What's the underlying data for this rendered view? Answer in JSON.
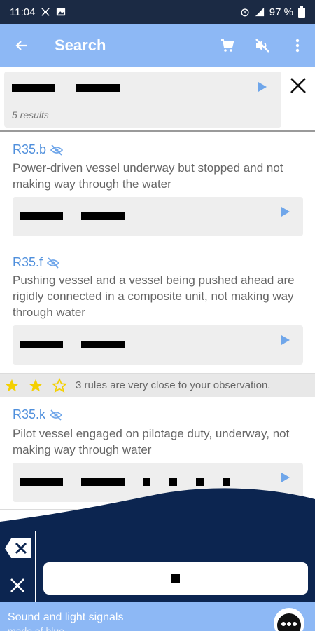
{
  "status_bar": {
    "time": "11:04",
    "battery": "97 %"
  },
  "app_bar": {
    "title": "Search",
    "back_icon": "arrow-back-icon",
    "actions": [
      "cart-icon",
      "volume-off-icon",
      "more-vert-icon"
    ]
  },
  "search": {
    "query_signal": [
      "dash",
      "dash"
    ],
    "results_count": "5 results"
  },
  "results": [
    {
      "rule_id": "R35.b",
      "description": "Power-driven vessel underway but stopped and not making way through the water",
      "signal": [
        "dash",
        "dash"
      ]
    },
    {
      "rule_id": "R35.f",
      "description": "Pushing vessel and a vessel being pushed ahead are rigidly connected in a composite unit, not making way through water",
      "signal": [
        "dash",
        "dash"
      ]
    },
    {
      "rule_id": "R35.k",
      "description": "Pilot vessel engaged on pilotage duty, underway, not making way through water",
      "signal": [
        "dash",
        "dash",
        "dot",
        "dot",
        "dot",
        "dot"
      ]
    }
  ],
  "rating": {
    "stars_filled": 2,
    "stars_total": 3,
    "text": "3 rules are very close to your observation."
  },
  "keyboard": {
    "backspace_icon": "backspace-icon",
    "cancel_icon": "close-icon",
    "dot_key_symbol": "dot"
  },
  "promo": {
    "title": "Sound and light signals",
    "subtitle": "made of blue"
  },
  "colors": {
    "status_bar": "#1b2a44",
    "app_bar": "#8db8f5",
    "accent_link": "#4f8fdc",
    "keyboard_bg": "#0c2550",
    "star": "#f4d000"
  }
}
